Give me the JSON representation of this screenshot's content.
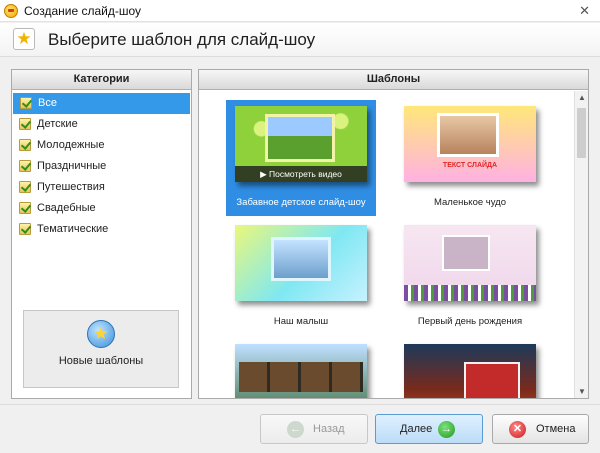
{
  "window": {
    "title": "Создание слайд-шоу",
    "close_glyph": "✕"
  },
  "header": {
    "title": "Выберите шаблон для слайд-шоу",
    "icon": "star-icon"
  },
  "categories": {
    "header": "Категории",
    "items": [
      {
        "label": "Все",
        "selected": true
      },
      {
        "label": "Детские",
        "selected": false
      },
      {
        "label": "Молодежные",
        "selected": false
      },
      {
        "label": "Праздничные",
        "selected": false
      },
      {
        "label": "Путешествия",
        "selected": false
      },
      {
        "label": "Свадебные",
        "selected": false
      },
      {
        "label": "Тематические",
        "selected": false
      }
    ],
    "new_templates_label": "Новые шаблоны"
  },
  "templates": {
    "header": "Шаблоны",
    "items": [
      {
        "caption": "Забавное детское слайд-шоу",
        "selected": true,
        "overlay": "▶ Посмотреть видео"
      },
      {
        "caption": "Маленькое чудо",
        "selected": false,
        "text_in_thumb": "ТЕКСТ СЛАЙДА"
      },
      {
        "caption": "Наш малыш",
        "selected": false
      },
      {
        "caption": "Первый день рождения",
        "selected": false
      },
      {
        "caption": "",
        "selected": false
      },
      {
        "caption": "",
        "selected": false
      }
    ]
  },
  "buttons": {
    "back": "Назад",
    "next": "Далее",
    "cancel": "Отмена"
  },
  "colors": {
    "selection": "#3399e8",
    "accent_green": "#1d9a1d",
    "cancel_red": "#d01818"
  }
}
